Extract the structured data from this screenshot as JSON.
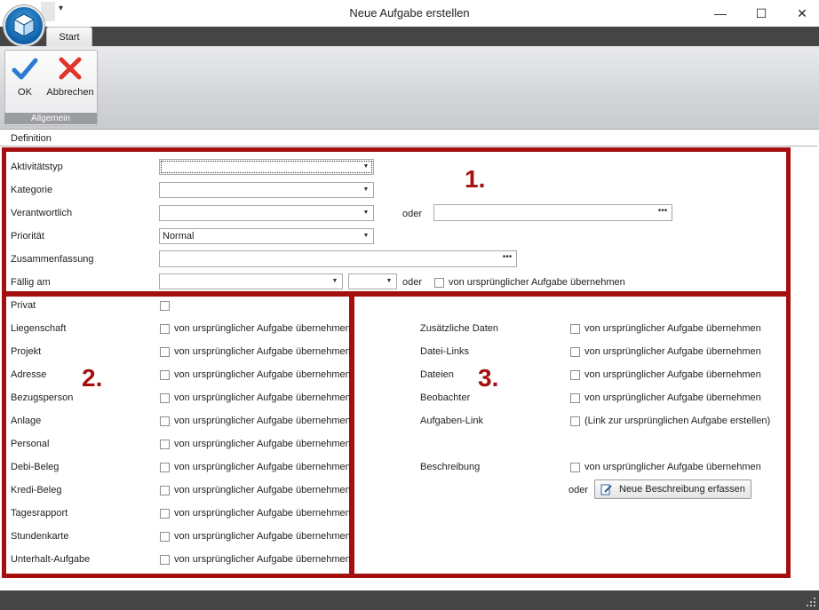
{
  "window": {
    "title": "Neue Aufgabe erstellen",
    "quick_access": "▾",
    "minimize": "—",
    "maximize": "☐",
    "close": "✕"
  },
  "tabs": [
    {
      "label": "Start"
    }
  ],
  "ribbon": {
    "ok_label": "OK",
    "cancel_label": "Abbrechen",
    "group_label": "Allgemein",
    "ok_color": "#2a7bd1",
    "cancel_color": "#e0352b"
  },
  "section": {
    "title": "Definition"
  },
  "box1": {
    "number": "1.",
    "aktivitaetstyp": {
      "label": "Aktivitätstyp",
      "value": ""
    },
    "kategorie": {
      "label": "Kategorie",
      "value": ""
    },
    "verantwortlich": {
      "label": "Verantwortlich",
      "value": "",
      "oder": "oder",
      "alt_value": ""
    },
    "prioritaet": {
      "label": "Priorität",
      "value": "Normal"
    },
    "zusammenfassung": {
      "label": "Zusammenfassung",
      "value": ""
    },
    "faellig": {
      "label": "Fällig am",
      "date_value": "",
      "time_value": "",
      "oder": "oder",
      "checkbox_label": "von ursprünglicher Aufgabe übernehmen"
    }
  },
  "box2": {
    "number": "2.",
    "privat": {
      "label": "Privat"
    },
    "checkbox_text": "von ursprünglicher Aufgabe übernehmen",
    "rows": [
      {
        "label": "Liegenschaft"
      },
      {
        "label": "Projekt"
      },
      {
        "label": "Adresse"
      },
      {
        "label": "Bezugsperson"
      },
      {
        "label": "Anlage"
      },
      {
        "label": "Personal"
      },
      {
        "label": "Debi-Beleg"
      },
      {
        "label": "Kredi-Beleg"
      },
      {
        "label": "Tagesrapport"
      },
      {
        "label": "Stundenkarte"
      },
      {
        "label": "Unterhalt-Aufgabe"
      }
    ]
  },
  "box3": {
    "number": "3.",
    "rows": [
      {
        "label": "Zusätzliche Daten",
        "checkbox_text": "von ursprünglicher Aufgabe übernehmen"
      },
      {
        "label": "Datei-Links",
        "checkbox_text": "von ursprünglicher Aufgabe übernehmen"
      },
      {
        "label": "Dateien",
        "checkbox_text": "von ursprünglicher Aufgabe übernehmen"
      },
      {
        "label": "Beobachter",
        "checkbox_text": "von ursprünglicher Aufgabe übernehmen"
      },
      {
        "label": "Aufgaben-Link",
        "checkbox_text": "(Link zur ursprünglichen Aufgabe erstellen)"
      }
    ],
    "beschreibung": {
      "label": "Beschreibung",
      "checkbox_text": "von ursprünglicher Aufgabe übernehmen",
      "oder": "oder",
      "button_label": "Neue Beschreibung erfassen"
    }
  },
  "colors": {
    "accent_red": "#a50f0f",
    "dark_band": "#454545"
  }
}
